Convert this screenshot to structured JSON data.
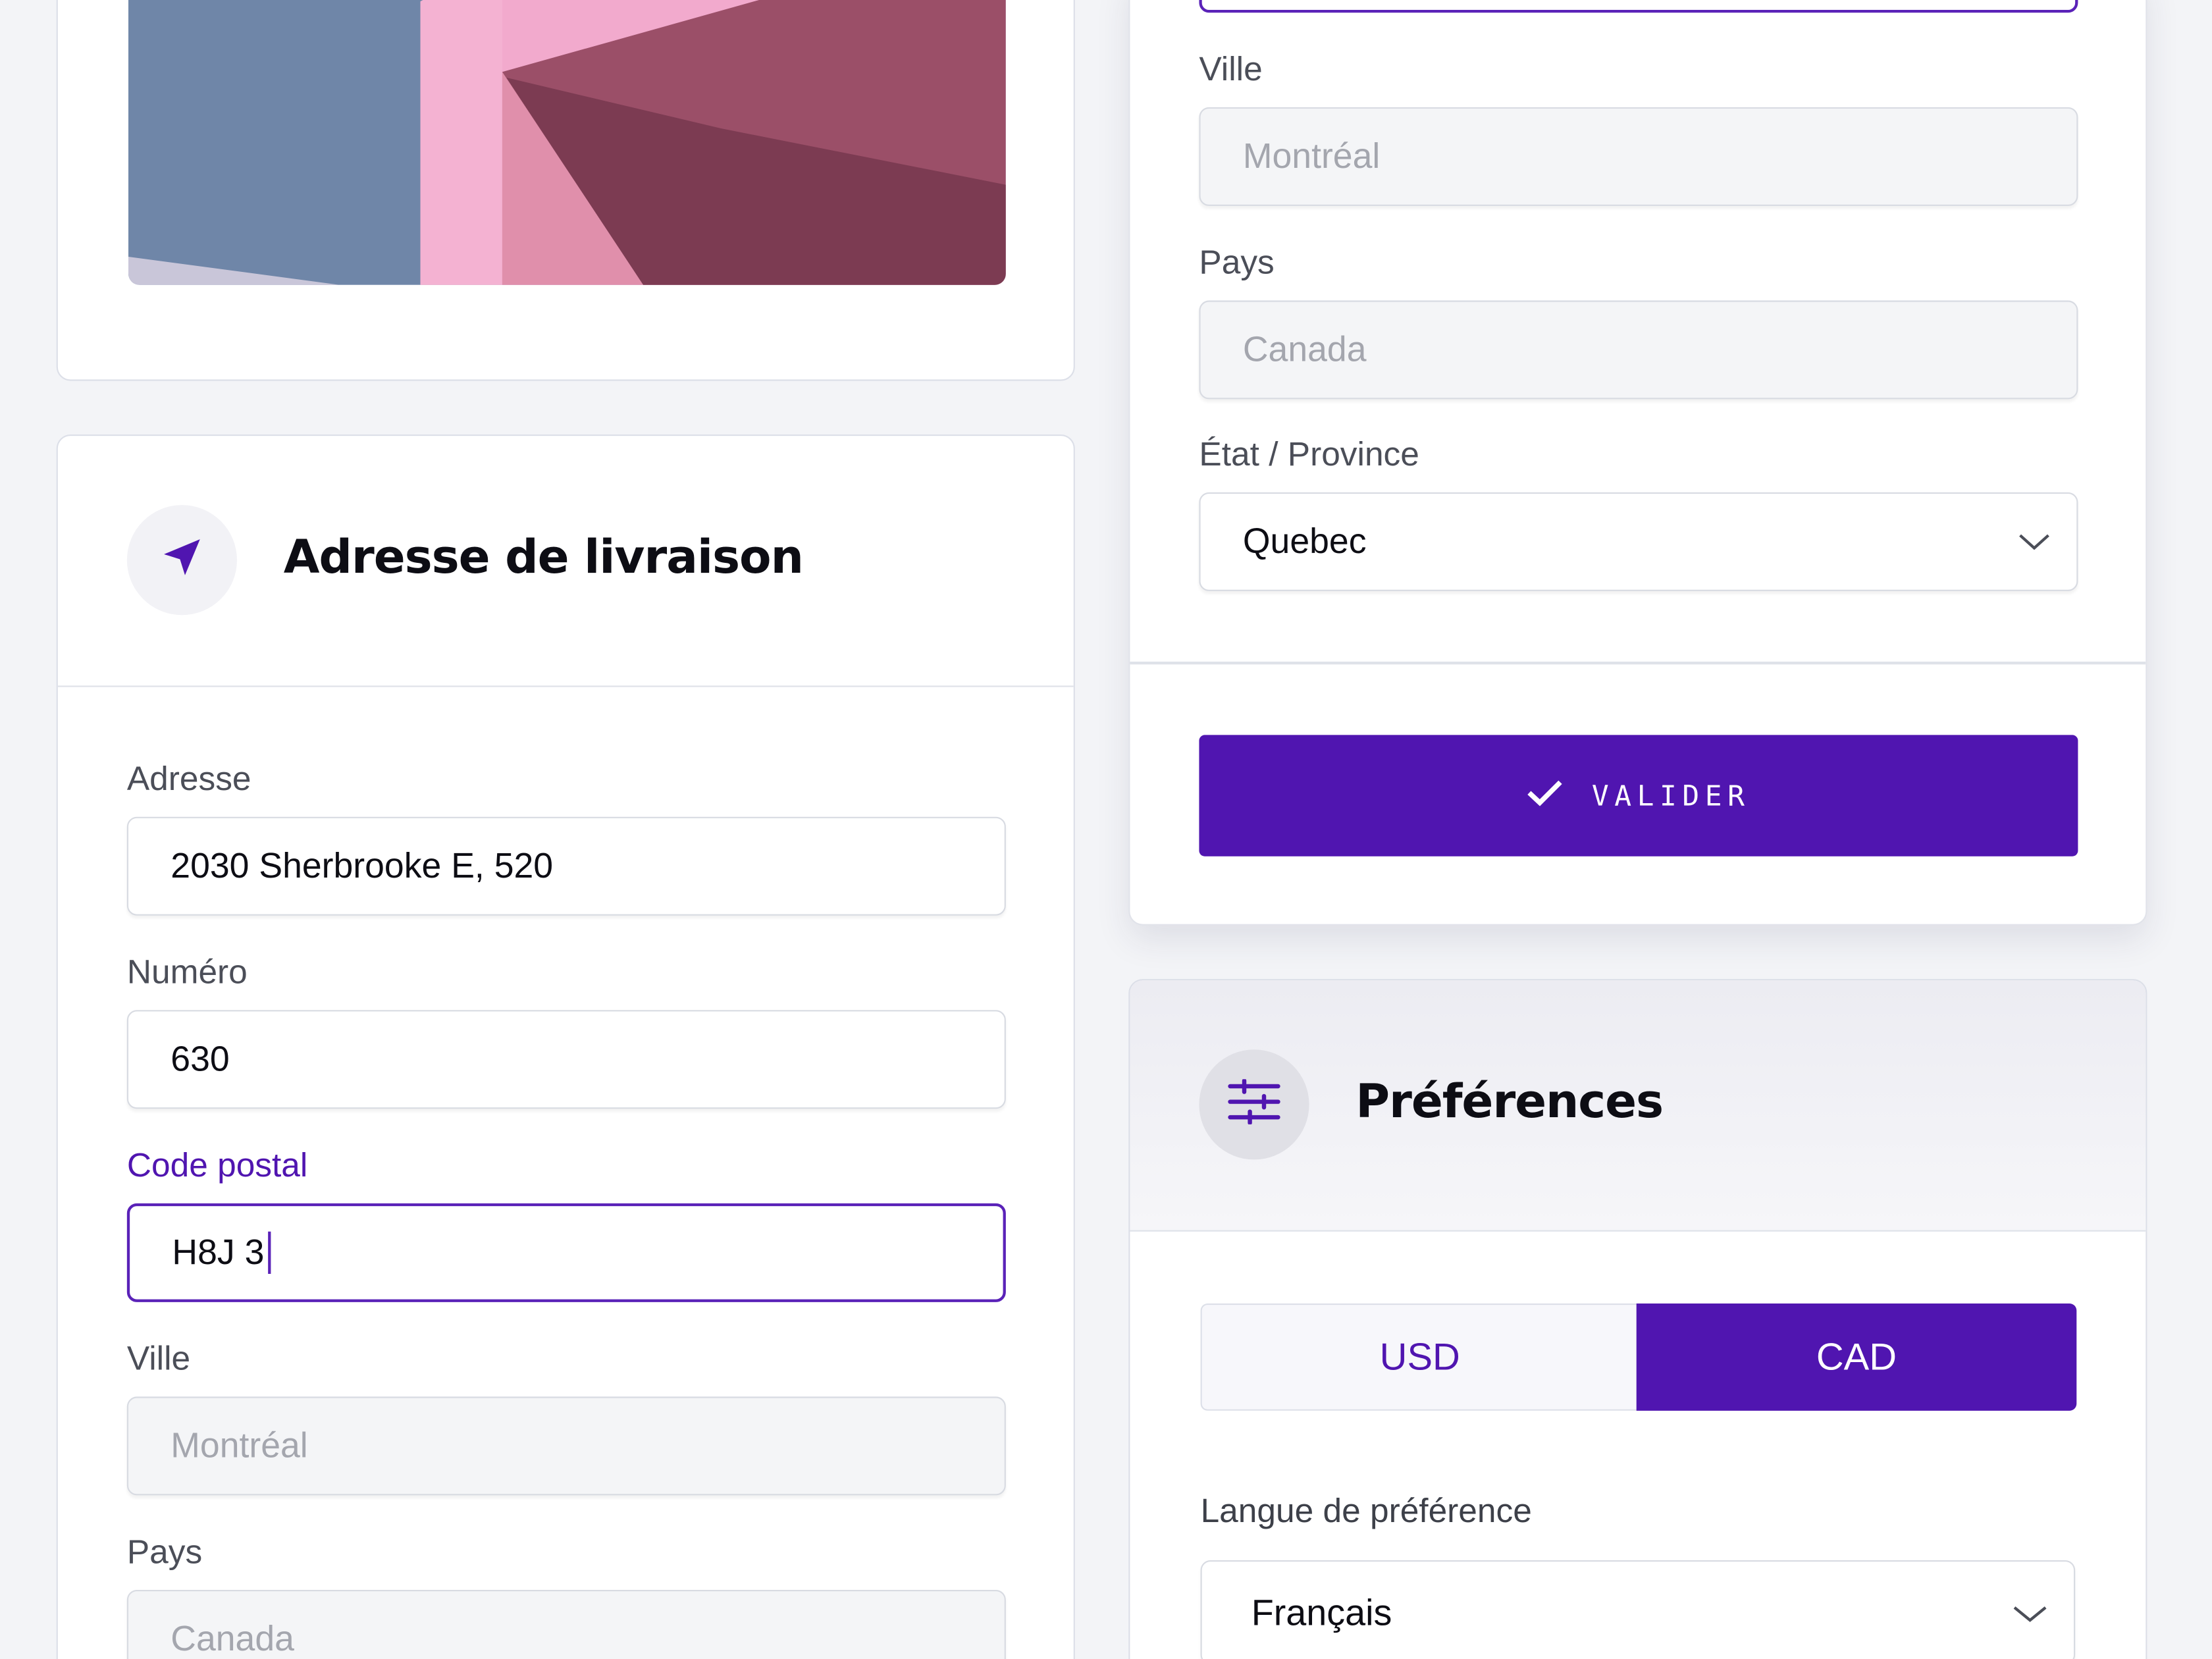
{
  "colors": {
    "accent": "#5015b0",
    "page_background": "#f3f4f7",
    "disabled_field": "#f4f5f7"
  },
  "shipping": {
    "title": "Adresse de livraison",
    "icon": "navigation-arrow-icon",
    "address_label": "Adresse",
    "address_value": "2030 Sherbrooke E, 520",
    "number_label": "Numéro",
    "number_value": "630",
    "postal_label": "Code postal",
    "postal_value": "H8J 3",
    "city_label": "Ville",
    "city_value": "Montréal",
    "country_label": "Pays",
    "country_value": "Canada"
  },
  "billing": {
    "city_label": "Ville",
    "city_value": "Montréal",
    "country_label": "Pays",
    "country_value": "Canada",
    "state_label": "État / Province",
    "state_value": "Quebec",
    "submit_label": "VALIDER",
    "submit_icon": "checkmark-icon"
  },
  "preferences": {
    "title": "Préférences",
    "icon": "sliders-icon",
    "currency_options": [
      "USD",
      "CAD"
    ],
    "currency_selected": "CAD",
    "language_label": "Langue de préférence",
    "language_value": "Français"
  }
}
